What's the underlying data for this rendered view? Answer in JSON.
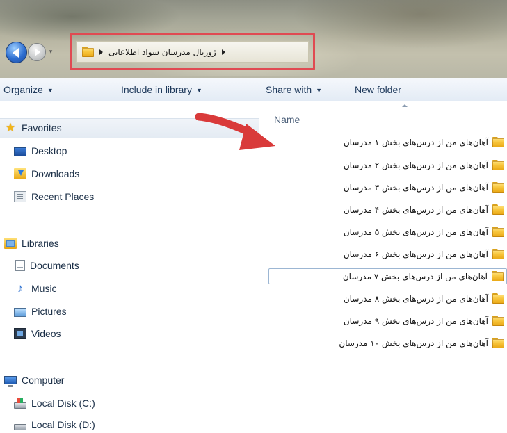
{
  "address_bar": {
    "path": "ژورنال مدرسان سواد اطلاعاتی"
  },
  "toolbar": {
    "organize": "Organize",
    "include_in_library": "Include in library",
    "share_with": "Share with",
    "new_folder": "New folder"
  },
  "navigation": {
    "favorites": "Favorites",
    "desktop": "Desktop",
    "downloads": "Downloads",
    "recent_places": "Recent Places",
    "libraries": "Libraries",
    "documents": "Documents",
    "music": "Music",
    "pictures": "Pictures",
    "videos": "Videos",
    "computer": "Computer",
    "local_disk_c": "Local Disk (C:)",
    "local_disk_d": "Local Disk (D:)"
  },
  "file_list": {
    "column_name": "Name",
    "items": [
      "آهان‌های من از درس‌های بخش ۱ مدرسان",
      "آهان‌های من از درس‌های بخش ۲ مدرسان",
      "آهان‌های من از درس‌های بخش ۳ مدرسان",
      "آهان‌های من از درس‌های بخش ۴ مدرسان",
      "آهان‌های من از درس‌های بخش ۵ مدرسان",
      "آهان‌های من از درس‌های بخش ۶ مدرسان",
      "آهان‌های من از درس‌های بخش ۷ مدرسان",
      "آهان‌های من از درس‌های بخش ۸ مدرسان",
      "آهان‌های من از درس‌های بخش ۹ مدرسان",
      "آهان‌های من از درس‌های بخش ۱۰ مدرسان"
    ]
  },
  "colors": {
    "highlight_red": "#e04a52",
    "toolbar_text": "#1e395b",
    "folder_yellow": "#f7c43a"
  }
}
